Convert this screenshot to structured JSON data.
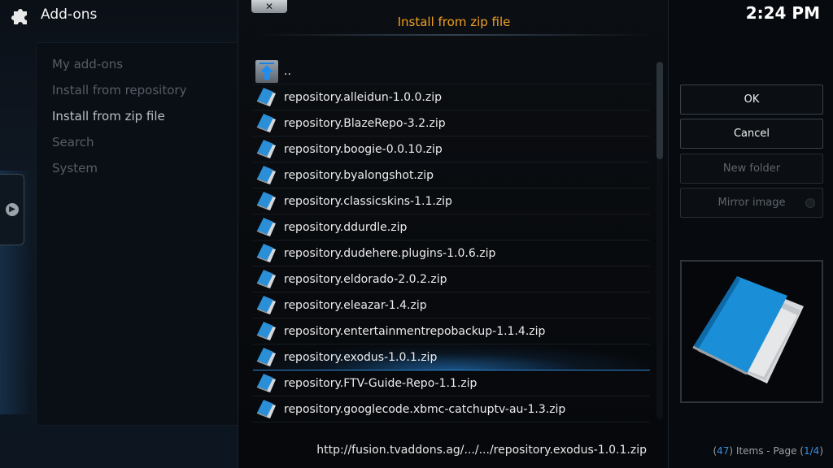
{
  "header": {
    "title": "Add-ons"
  },
  "sidebar": {
    "items": [
      {
        "label": "My add-ons"
      },
      {
        "label": "Install from repository"
      },
      {
        "label": "Install from zip file"
      },
      {
        "label": "Search"
      },
      {
        "label": "System"
      }
    ]
  },
  "dialog": {
    "close_label": "✕",
    "title": "Install from zip file",
    "parent_label": "..",
    "files": [
      "repository.alleidun-1.0.0.zip",
      "repository.BlazeRepo-3.2.zip",
      "repository.boogie-0.0.10.zip",
      "repository.byalongshot.zip",
      "repository.classicskins-1.1.zip",
      "repository.ddurdle.zip",
      "repository.dudehere.plugins-1.0.6.zip",
      "repository.eldorado-2.0.2.zip",
      "repository.eleazar-1.4.zip",
      "repository.entertainmentrepobackup-1.1.4.zip",
      "repository.exodus-1.0.1.zip",
      "repository.FTV-Guide-Repo-1.1.zip",
      "repository.googlecode.xbmc-catchuptv-au-1.3.zip"
    ],
    "selected_file": "repository.exodus-1.0.1.zip",
    "path": "http://fusion.tvaddons.ag/.../.../repository.exodus-1.0.1.zip"
  },
  "right_panel": {
    "clock": "2:24 PM",
    "ok_label": "OK",
    "cancel_label": "Cancel",
    "new_folder_label": "New folder",
    "mirror_image_label": "Mirror image",
    "items_prefix": "(",
    "items_count": "47",
    "items_middle": ") Items - Page (",
    "page_current": "1/4",
    "items_suffix": ")"
  },
  "colors": {
    "accent": "#3c8fe0",
    "title": "#f0a020",
    "background": "#05080c"
  }
}
